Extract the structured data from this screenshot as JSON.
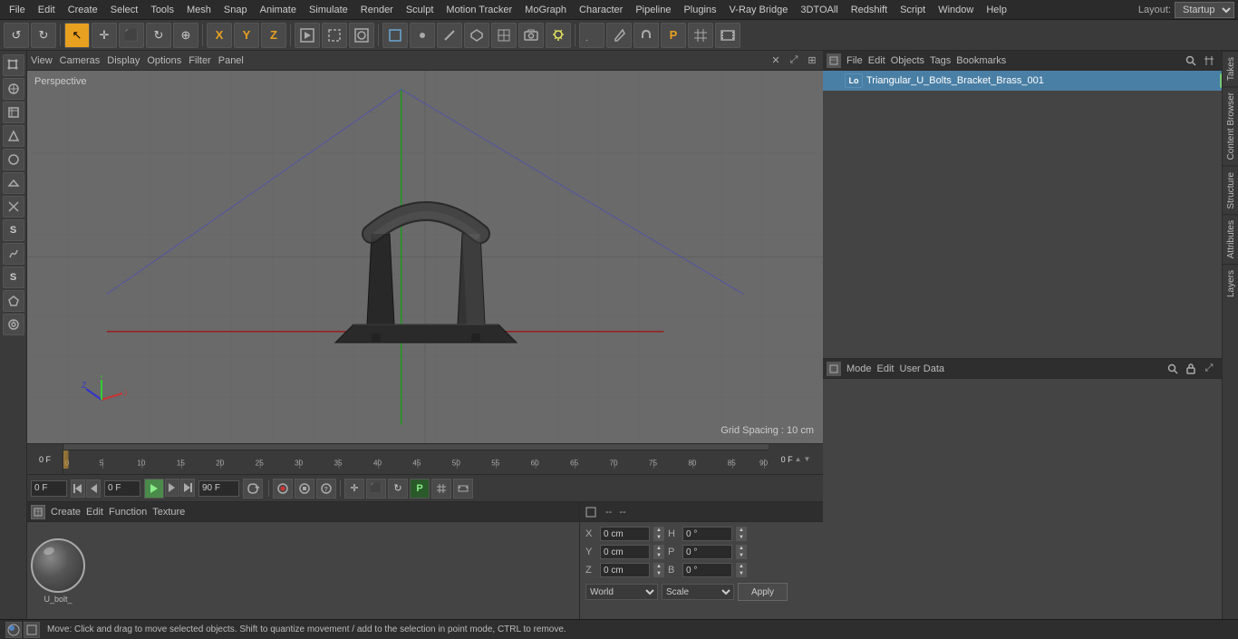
{
  "menubar": {
    "items": [
      "File",
      "Edit",
      "Create",
      "Select",
      "Tools",
      "Mesh",
      "Snap",
      "Animate",
      "Simulate",
      "Render",
      "Sculpt",
      "Motion Tracker",
      "MoGraph",
      "Character",
      "Pipeline",
      "Plugins",
      "V-Ray Bridge",
      "3DTOAll",
      "Redshift",
      "Script",
      "Window",
      "Help"
    ],
    "layout_label": "Layout:",
    "layout_value": "Startup"
  },
  "toolbar": {
    "undo_label": "↺",
    "redo_label": "↻",
    "select_label": "↖",
    "move_label": "✛",
    "scale_label": "⬛",
    "rotate_label": "↻",
    "camera_label": "⊕",
    "x_label": "X",
    "y_label": "Y",
    "z_label": "Z",
    "object_label": "□",
    "points_label": "·",
    "edges_label": "⌇",
    "polygon_label": "◻"
  },
  "viewport": {
    "perspective_label": "Perspective",
    "grid_spacing_label": "Grid Spacing : 10 cm",
    "header_items": [
      "View",
      "Cameras",
      "Display",
      "Options",
      "Filter",
      "Panel"
    ]
  },
  "sidebar_left": {
    "tools": [
      "↖",
      "✛",
      "◻",
      "⬡",
      "◈",
      "S",
      "◯",
      "⬡",
      "△",
      "S",
      "⬡",
      "⊕"
    ]
  },
  "timeline": {
    "start_frame": "0 F",
    "end_frame": "0 F",
    "ticks": [
      0,
      5,
      10,
      15,
      20,
      25,
      30,
      35,
      40,
      45,
      50,
      55,
      60,
      65,
      70,
      75,
      80,
      85,
      90
    ],
    "current_frame": "0 F",
    "total_frames": "90 F F"
  },
  "transport": {
    "frame_start": "0 F",
    "frame_current": "0 F",
    "frame_end": "90 F",
    "buttons": [
      "⏮",
      "◀",
      "▶",
      "▶▶",
      "⏭"
    ],
    "play_label": "▶",
    "record_label": "⏺",
    "help_label": "?"
  },
  "object_manager": {
    "title_items": [
      "File",
      "Edit",
      "Objects",
      "Tags",
      "Bookmarks"
    ],
    "object_name": "Triangular_U_Bolts_Bracket_Brass_001",
    "object_icon": "Lo",
    "object_tag_color": "#77cc77"
  },
  "attribute_manager": {
    "title_items": [
      "Mode",
      "Edit",
      "User Data"
    ],
    "header_left": "--",
    "header_right": "--",
    "rows": [
      {
        "label": "X",
        "val1": "0 cm",
        "val2": "H",
        "val3": "0 °"
      },
      {
        "label": "Y",
        "val1": "0 cm",
        "val2": "P",
        "val3": "0 °"
      },
      {
        "label": "Z",
        "val1": "0 cm",
        "val2": "B",
        "val3": "0 °"
      }
    ],
    "col_x_header": "X",
    "col_y_header": "Y",
    "world_label": "World",
    "scale_label": "Scale",
    "apply_label": "Apply"
  },
  "material_panel": {
    "header_items": [
      "Create",
      "Edit",
      "Function",
      "Texture"
    ],
    "material_name": "U_bolt_",
    "sphere_label": "U_bolt_"
  },
  "status_bar": {
    "text": "Move: Click and drag to move selected objects. Shift to quantize movement / add to the selection in point mode, CTRL to remove.",
    "icon_a": "A",
    "icon_b": "□"
  },
  "vertical_tabs": {
    "takes": "Takes",
    "content_browser": "Content Browser",
    "structure": "Structure",
    "attributes": "Attributes",
    "layers": "Layers"
  }
}
